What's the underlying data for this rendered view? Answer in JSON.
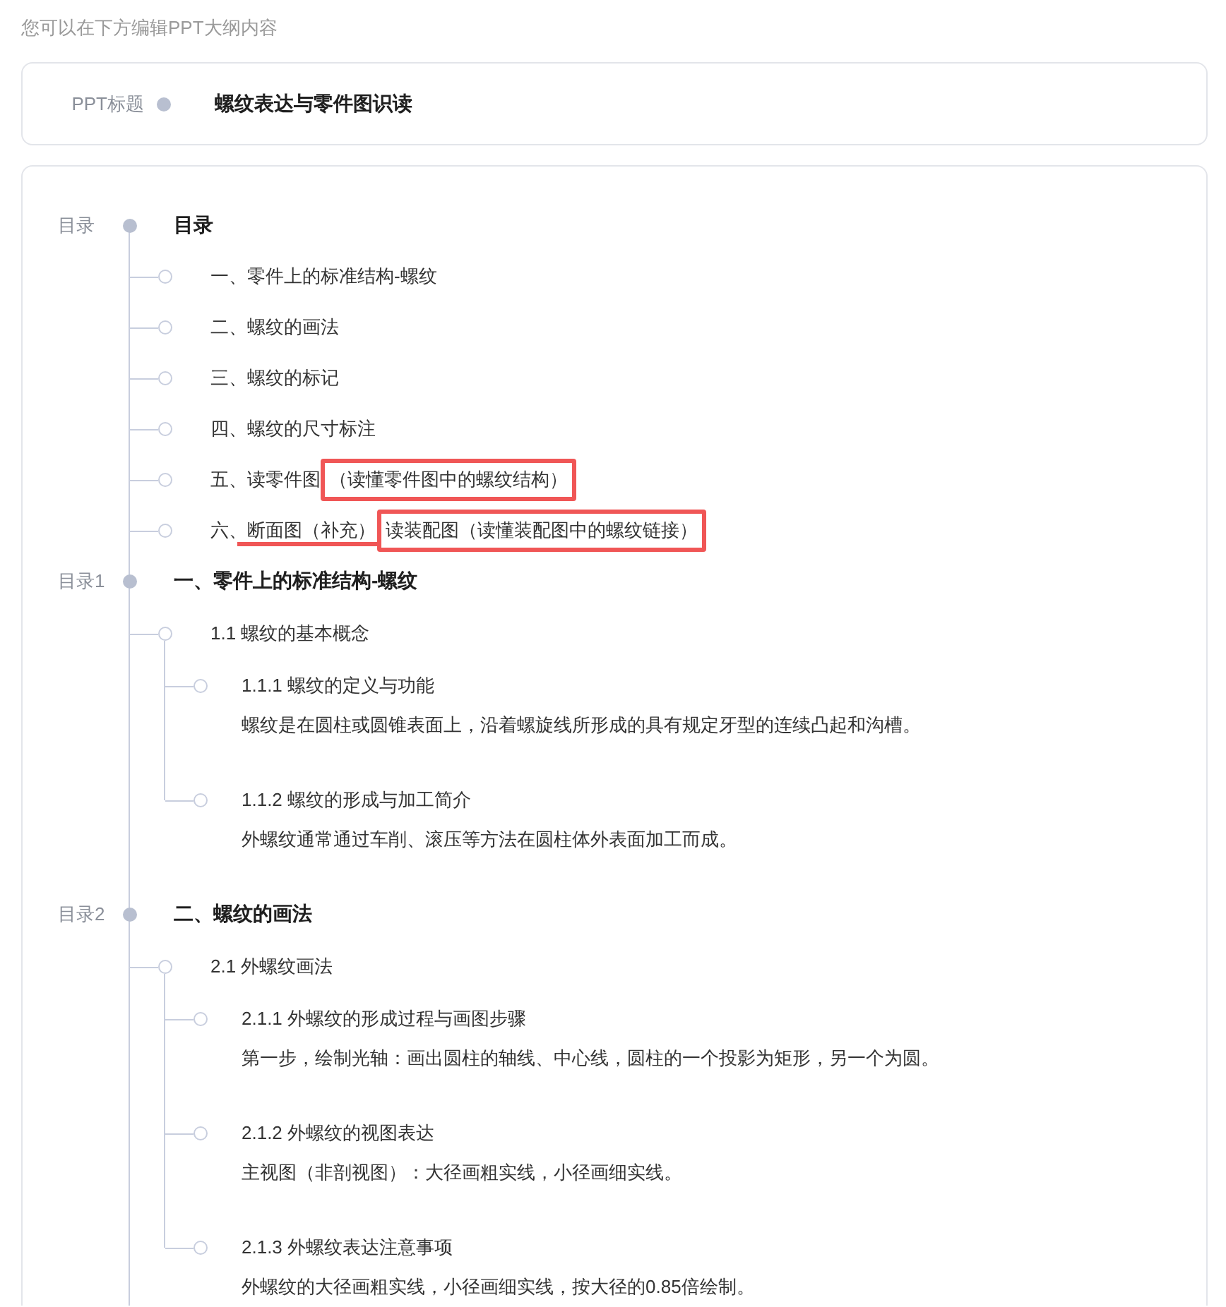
{
  "caption": "您可以在下方编辑PPT大纲内容",
  "title": {
    "label": "PPT标题",
    "value": "螺纹表达与零件图识读"
  },
  "sections": [
    {
      "label": "目录",
      "heading": "目录",
      "items": [
        {
          "parts": [
            {
              "kind": "plain",
              "text": "一、零件上的标准结构-螺纹"
            }
          ]
        },
        {
          "parts": [
            {
              "kind": "plain",
              "text": "二、螺纹的画法"
            }
          ]
        },
        {
          "parts": [
            {
              "kind": "plain",
              "text": "三、螺纹的标记"
            }
          ]
        },
        {
          "parts": [
            {
              "kind": "plain",
              "text": "四、螺纹的尺寸标注"
            }
          ]
        },
        {
          "parts": [
            {
              "kind": "plain",
              "text": "五、读零件图"
            },
            {
              "kind": "boxed",
              "text": "（读懂零件图中的螺纹结构）"
            }
          ]
        },
        {
          "parts": [
            {
              "kind": "plain",
              "text": "六、"
            },
            {
              "kind": "struck",
              "text": "断面图（补充）"
            },
            {
              "kind": "boxed",
              "text": "读装配图（读懂装配图中的螺纹链接）"
            }
          ]
        }
      ]
    },
    {
      "label": "目录1",
      "heading": "一、零件上的标准结构-螺纹",
      "items": [
        {
          "parts": [
            {
              "kind": "plain",
              "text": "1.1 螺纹的基本概念"
            }
          ],
          "children": [
            {
              "title": "1.1.1 螺纹的定义与功能",
              "text": "螺纹是在圆柱或圆锥表面上，沿着螺旋线所形成的具有规定牙型的连续凸起和沟槽。"
            },
            {
              "title": "1.1.2 螺纹的形成与加工简介",
              "text": "外螺纹通常通过车削、滚压等方法在圆柱体外表面加工而成。"
            }
          ]
        }
      ]
    },
    {
      "label": "目录2",
      "heading": "二、螺纹的画法",
      "items": [
        {
          "parts": [
            {
              "kind": "plain",
              "text": "2.1 外螺纹画法"
            }
          ],
          "children": [
            {
              "title": "2.1.1 外螺纹的形成过程与画图步骤",
              "text": "第一步，绘制光轴：画出圆柱的轴线、中心线，圆柱的一个投影为矩形，另一个为圆。"
            },
            {
              "title": "2.1.2 外螺纹的视图表达",
              "text": "主视图（非剖视图）：大径画粗实线，小径画细实线。"
            },
            {
              "title": "2.1.3 外螺纹表达注意事项",
              "text": "外螺纹的大径画粗实线，小径画细实线，按大径的0.85倍绘制。"
            }
          ]
        }
      ]
    }
  ]
}
